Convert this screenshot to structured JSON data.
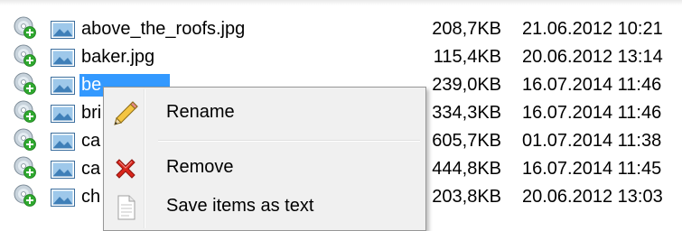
{
  "files": [
    {
      "name": "above_the_roofs.jpg",
      "size": "208,7KB",
      "date": "21.06.2012 10:21",
      "selected": false
    },
    {
      "name": "baker.jpg",
      "size": "115,4KB",
      "date": "20.06.2012 13:14",
      "selected": false
    },
    {
      "name": "be...",
      "size": "239,0KB",
      "date": "16.07.2014 11:46",
      "selected": true
    },
    {
      "name": "bri",
      "size": "334,3KB",
      "date": "16.07.2014 11:46",
      "selected": false
    },
    {
      "name": "ca",
      "size": "605,7KB",
      "date": "01.07.2014 11:38",
      "selected": false
    },
    {
      "name": "ca",
      "size": "444,8KB",
      "date": "16.07.2014 11:45",
      "selected": false
    },
    {
      "name": "ch",
      "size": "203,8KB",
      "date": "20.06.2012 13:03",
      "selected": false
    }
  ],
  "context_menu": {
    "items": [
      {
        "label": "Rename",
        "icon": "pencil-icon"
      },
      {
        "label": "Remove",
        "icon": "red-x-icon"
      },
      {
        "label": "Save items as text",
        "icon": "document-icon"
      }
    ]
  },
  "colors": {
    "selection": "#3399ff",
    "menu_background": "#f0f0f0",
    "menu_border": "#979797",
    "add_badge": "#2fa82f",
    "remove_red": "#d9261c"
  }
}
